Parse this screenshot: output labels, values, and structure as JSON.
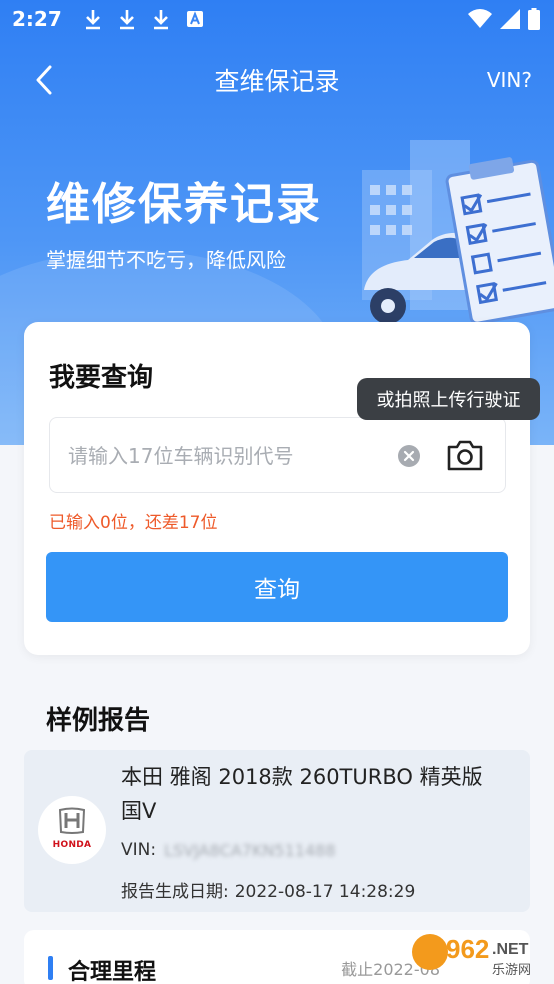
{
  "status_bar": {
    "time": "2:27"
  },
  "nav": {
    "title": "查维保记录",
    "vin_help": "VIN?"
  },
  "hero": {
    "title": "维修保养记录",
    "subtitle": "掌握细节不吃亏，降低风险"
  },
  "query": {
    "title": "我要查询",
    "placeholder": "请输入17位车辆识别代号",
    "value": "",
    "tooltip": "或拍照上传行驶证",
    "hint": "已输入0位，还差17位",
    "button": "查询"
  },
  "sample": {
    "heading": "样例报告",
    "brand": "HONDA",
    "car_name": "本田 雅阁 2018款 260TURBO 精英版 国V",
    "vin_label": "VIN:",
    "vin_value": "LSVJA8CA7KN511488",
    "date_label": "报告生成日期:",
    "date_value": "2022-08-17 14:28:29"
  },
  "mileage": {
    "title": "合理里程",
    "note": "截止2022-08"
  },
  "watermark": {
    "digits": "962",
    "suffix": ".NET",
    "sub": "乐游网"
  },
  "colors": {
    "primary": "#3495f7",
    "hint": "#ee5a2a",
    "hero_top": "#2f7ff3"
  }
}
